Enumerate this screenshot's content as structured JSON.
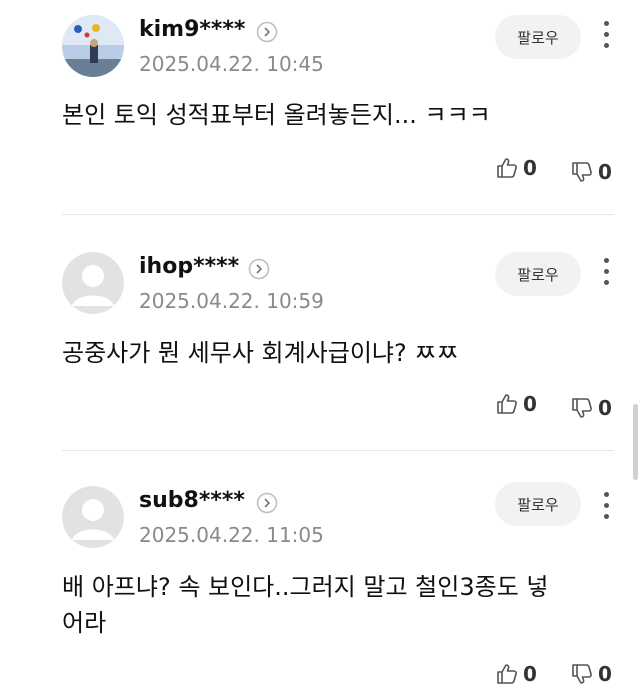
{
  "comments": [
    {
      "username": "kim9****",
      "timestamp": "2025.04.22. 10:45",
      "text": "본인 토익 성적표부터 올려놓든지... ㅋㅋㅋ",
      "follow_label": "팔로우",
      "likes": "0",
      "dislikes": "0",
      "avatar": "photo"
    },
    {
      "username": "ihop****",
      "timestamp": "2025.04.22. 10:59",
      "text": "공중사가 뭔 세무사 회계사급이냐? ㅉㅉ",
      "follow_label": "팔로우",
      "likes": "0",
      "dislikes": "0",
      "avatar": "default"
    },
    {
      "username": "sub8****",
      "timestamp": "2025.04.22. 11:05",
      "text": "배 아프냐? 속 보인다..그러지 말고 철인3종도 넣어라",
      "follow_label": "팔로우",
      "likes": "0",
      "dislikes": "0",
      "avatar": "default"
    }
  ],
  "icons": {
    "like": "thumbs-up-icon",
    "dislike": "thumbs-down-icon",
    "more": "more-vertical-icon",
    "profile": "chevron-right-icon"
  }
}
